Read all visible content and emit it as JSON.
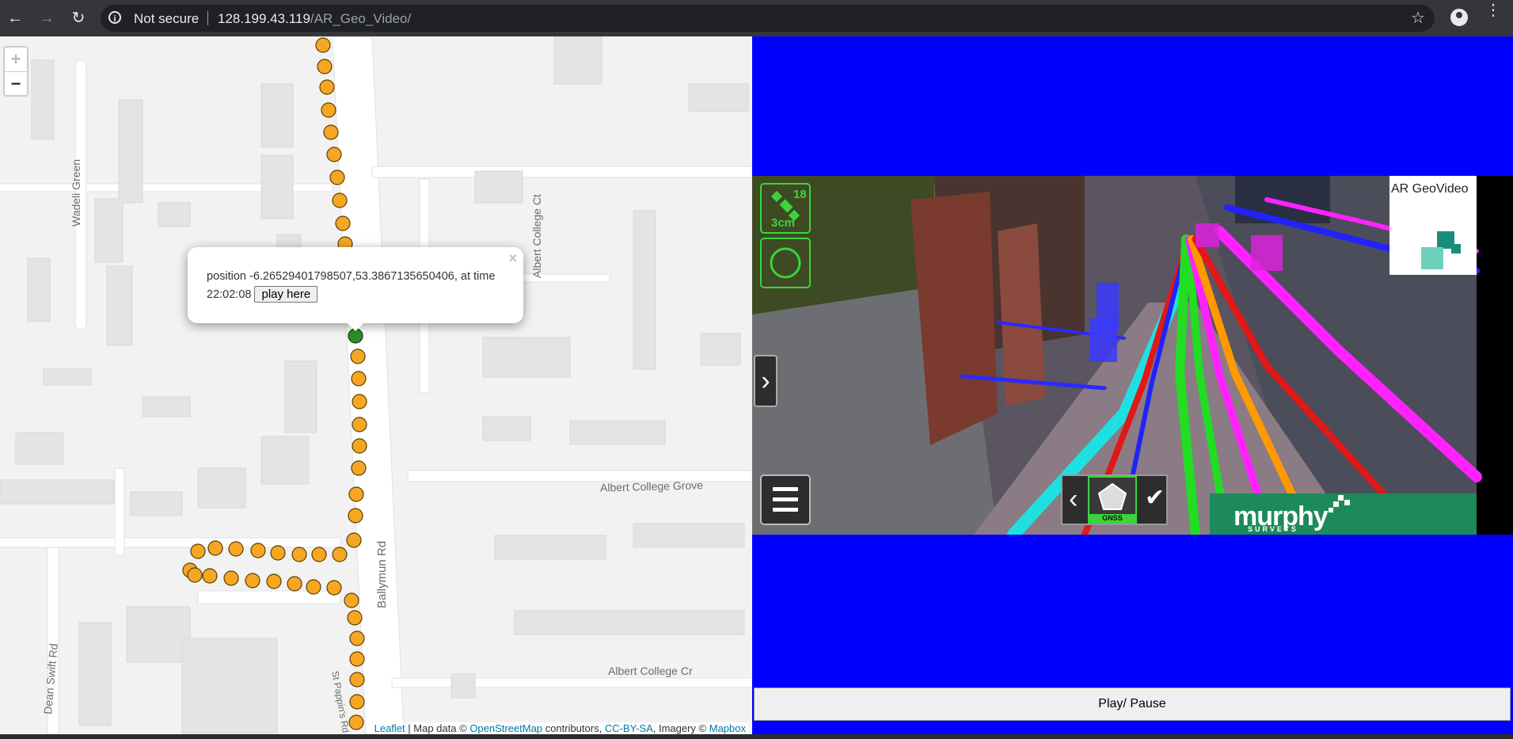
{
  "browser": {
    "security_label": "Not secure",
    "url_host": "128.199.43.119",
    "url_path": "/AR_Geo_Video/"
  },
  "map": {
    "zoom_in": "+",
    "zoom_out": "−",
    "streets": {
      "wadeli_green": "Wadeli Green",
      "albert_college_ct": "Albert College Ct",
      "albert_college_grove": "Albert College Grove",
      "ballymun_rd": "Ballymun Rd",
      "albert_college_cr": "Albert College Cr",
      "dean_swift_rd": "Dean Swift Rd",
      "st_pappins_rd": "St Pappin's Rd"
    },
    "popup": {
      "close": "×",
      "text": "position -6.26529401798507,53.3867135650406, at time 22:02:08",
      "button": "play here"
    },
    "attribution": {
      "leaflet": "Leaflet",
      "sep1": " | Map data © ",
      "osm": "OpenStreetMap",
      "sep2": " contributors, ",
      "license": "CC-BY-SA",
      "sep3": ", Imagery © ",
      "mapbox": "Mapbox"
    }
  },
  "video": {
    "gnss_satellites": "18",
    "gnss_accuracy": "3cm",
    "brand_title": "AR GeoVideo",
    "company_name": "murphy",
    "company_sub": "SURVEYS",
    "tool_label": "GNSS"
  },
  "controls": {
    "play_pause": "Play/ Pause"
  },
  "colors": {
    "panel_bg": "#0000ff",
    "track_point": "#f5a623",
    "active_point": "#2e8b2e",
    "hud_green": "#3bd43b"
  }
}
